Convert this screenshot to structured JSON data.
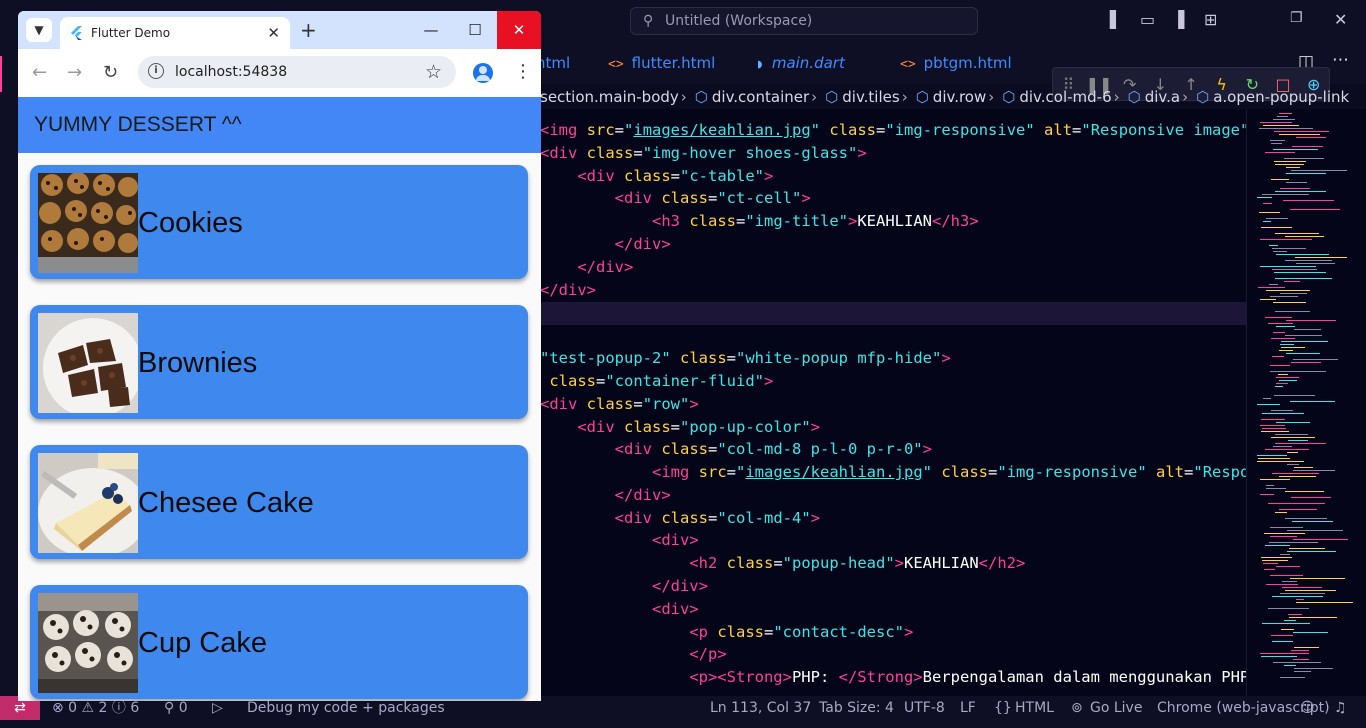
{
  "vscode": {
    "search_text": "Untitled (Workspace)",
    "tabs": [
      {
        "label": "html",
        "icon": "html-file-icon"
      },
      {
        "label": "flutter.html",
        "icon": "html-file-icon"
      },
      {
        "label": "main.dart",
        "icon": "dart-file-icon"
      },
      {
        "label": "pbtgm.html",
        "icon": "html-file-icon"
      }
    ],
    "breadcrumbs": [
      "section.main-body",
      "div.container",
      "div.tiles",
      "div.row",
      "div.col-md-6",
      "div.a",
      "a.open-popup-link"
    ],
    "status": {
      "remote": "⇄",
      "problems": "⊗ 0 ⚠ 2 ⓘ 6",
      "ports": "⚲ 0",
      "debug": "Debug my code + packages",
      "position": "Ln 113, Col 37",
      "tab_size": "Tab Size: 4",
      "encoding": "UTF-8",
      "eol": "LF",
      "language": "HTML",
      "golive": "Go Live",
      "chrome": "Chrome (web-javascript)"
    }
  },
  "chrome": {
    "tab_title": "Flutter Demo",
    "url": "localhost:54838"
  },
  "app": {
    "title": "YUMMY DESSERT ^^",
    "items": [
      {
        "name": "Cookies"
      },
      {
        "name": "Brownies"
      },
      {
        "name": "Chesee Cake"
      },
      {
        "name": "Cup Cake"
      }
    ]
  },
  "colors": {
    "app_bar": "#4287f5",
    "card": "#3f88ee",
    "editor_bg": "#050519",
    "tag": "#ff3f9b",
    "attr": "#ffd23f",
    "string": "#3de6e6"
  }
}
